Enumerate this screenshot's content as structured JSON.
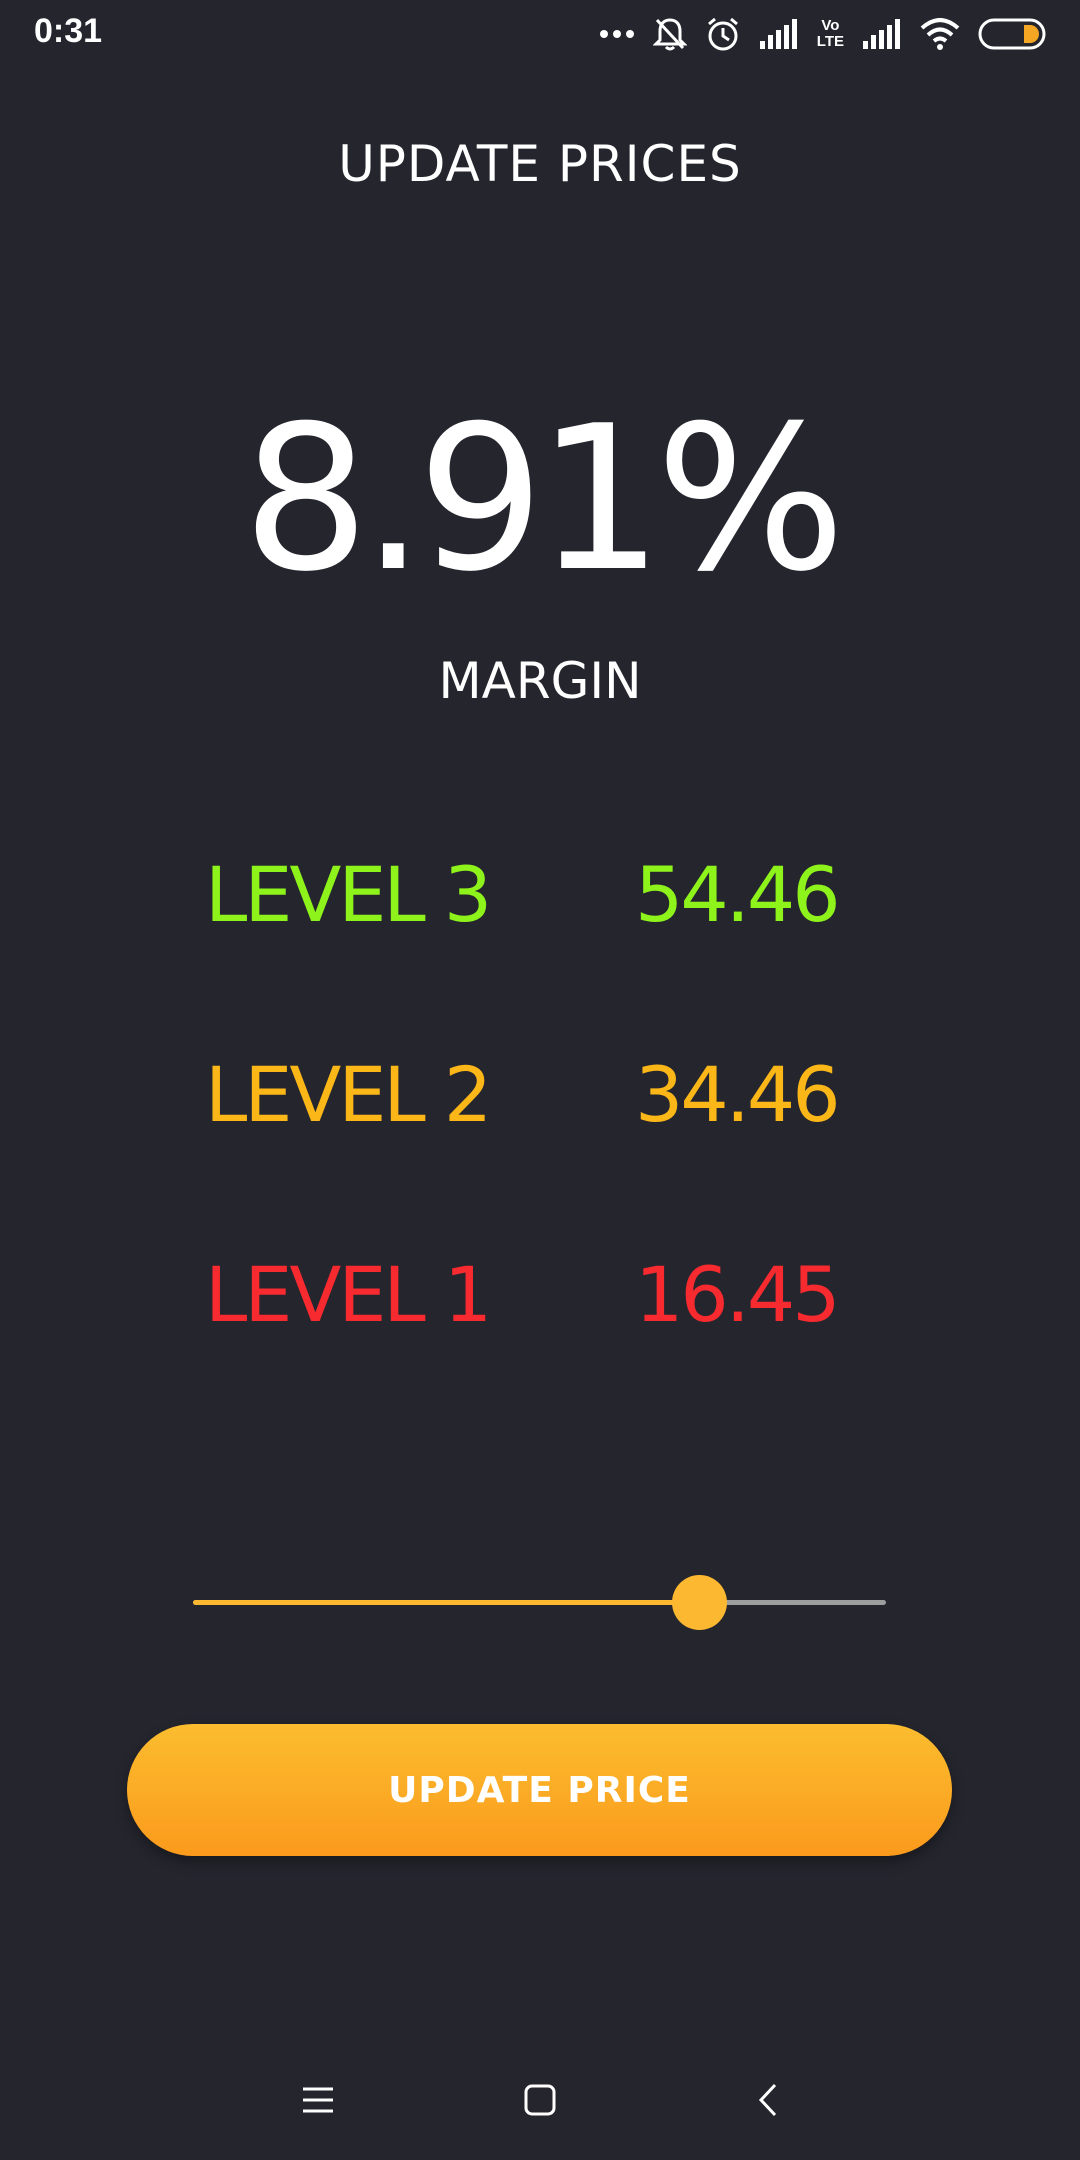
{
  "status_bar": {
    "time": "0:31",
    "lte_text": "Vo\nLTE",
    "icons": [
      "more-dots-icon",
      "bell-muted-icon",
      "alarm-icon",
      "signal-icon",
      "volte-icon",
      "signal-icon",
      "wifi-icon",
      "battery-icon"
    ]
  },
  "header": {
    "title": "UPDATE PRICES"
  },
  "margin": {
    "value": "8.91%",
    "label": "MARGIN"
  },
  "levels": [
    {
      "label": "LEVEL 3",
      "value": "54.46",
      "color": "#8ef21b"
    },
    {
      "label": "LEVEL 2",
      "value": "34.46",
      "color": "#fbb718"
    },
    {
      "label": "LEVEL 1",
      "value": "16.45",
      "color": "#f62a2f"
    }
  ],
  "slider": {
    "value_fraction": 0.73,
    "accent_color": "#fbb830"
  },
  "actions": {
    "update_label": "UPDATE PRICE"
  },
  "nav_bar": {
    "icons": [
      "menu-icon",
      "home-square-icon",
      "back-chevron-icon"
    ]
  },
  "colors": {
    "background": "#25252e",
    "button_gradient_top": "#fbbd2f",
    "button_gradient_bottom": "#fb9a1c"
  }
}
